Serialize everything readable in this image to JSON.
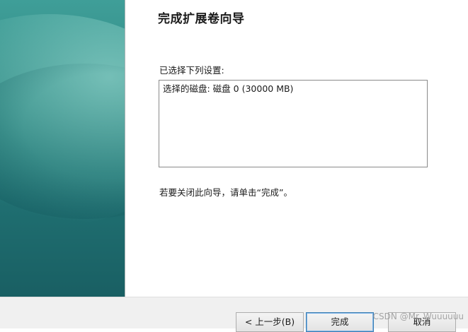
{
  "wizard": {
    "title": "完成扩展卷向导",
    "settings_label": "已选择下列设置:",
    "summary_lines": [
      "选择的磁盘: 磁盘 0 (30000 MB)"
    ],
    "finish_hint": "若要关闭此向导，请单击“完成”。"
  },
  "buttons": {
    "back_label": "< 上一步(B)",
    "finish_label": "完成",
    "cancel_label": "取消"
  },
  "watermark": "CSDN @Mr_Wuuuuuu",
  "colors": {
    "banner_top": "#3f9e98",
    "banner_bottom": "#195f63",
    "button_bar": "#f0f0f0"
  }
}
